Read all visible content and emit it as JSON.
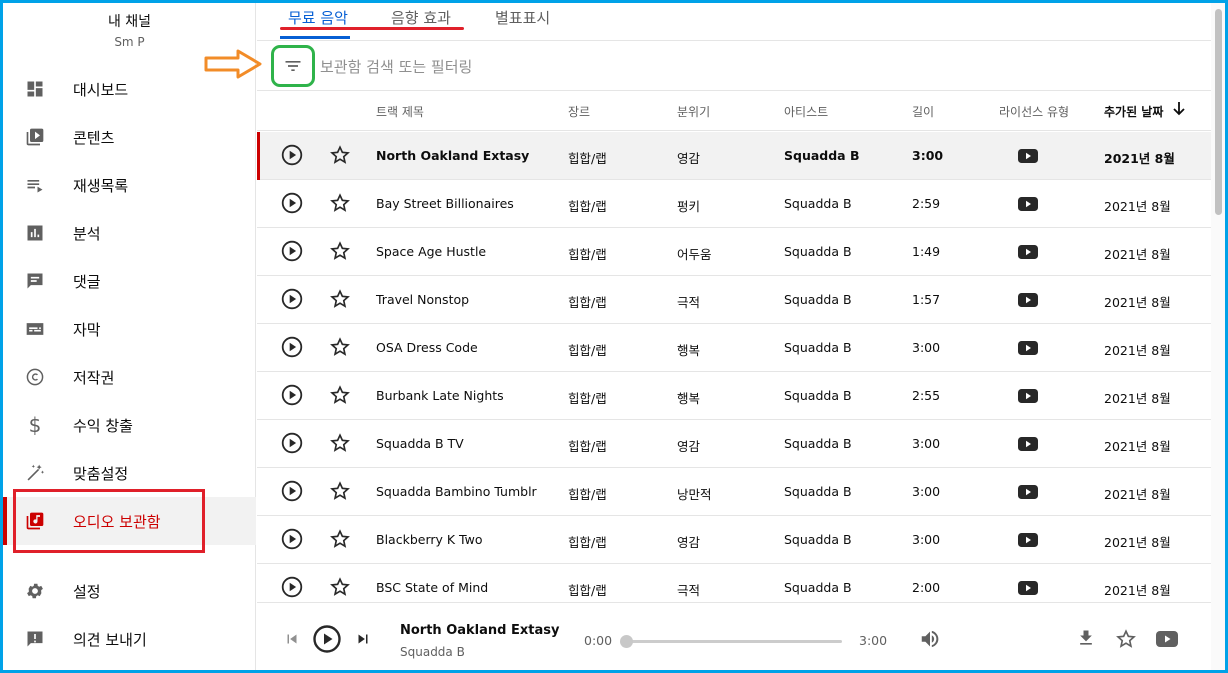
{
  "channel": {
    "name": "내 채널",
    "handle": "Sm P"
  },
  "sidebar": {
    "items": [
      {
        "label": "대시보드",
        "icon": "dashboard-icon"
      },
      {
        "label": "콘텐츠",
        "icon": "content-icon"
      },
      {
        "label": "재생목록",
        "icon": "playlist-icon"
      },
      {
        "label": "분석",
        "icon": "analytics-icon"
      },
      {
        "label": "댓글",
        "icon": "comment-icon"
      },
      {
        "label": "자막",
        "icon": "subtitles-icon"
      },
      {
        "label": "저작권",
        "icon": "copyright-icon"
      },
      {
        "label": "수익 창출",
        "icon": "dollar-icon"
      },
      {
        "label": "맞춤설정",
        "icon": "magic-wand-icon"
      },
      {
        "label": "오디오 보관함",
        "icon": "audio-library-icon",
        "active": true
      },
      {
        "label": "설정",
        "icon": "gear-icon"
      },
      {
        "label": "의견 보내기",
        "icon": "feedback-icon"
      }
    ]
  },
  "tabs": [
    {
      "label": "무료 음악",
      "active": true
    },
    {
      "label": "음향 효과"
    },
    {
      "label": "별표표시"
    }
  ],
  "filter": {
    "placeholder": "보관함 검색 또는 필터링"
  },
  "columns": {
    "title": "트랙 제목",
    "genre": "장르",
    "mood": "분위기",
    "artist": "아티스트",
    "length": "길이",
    "license": "라이선스 유형",
    "date": "추가된 날짜",
    "sort_icon": "arrow-down-icon"
  },
  "tracks": [
    {
      "title": "North Oakland Extasy",
      "genre": "힙합/랩",
      "mood": "영감",
      "artist": "Squadda B",
      "length": "3:00",
      "date": "2021년 8월"
    },
    {
      "title": "Bay Street Billionaires",
      "genre": "힙합/랩",
      "mood": "펑키",
      "artist": "Squadda B",
      "length": "2:59",
      "date": "2021년 8월"
    },
    {
      "title": "Space Age Hustle",
      "genre": "힙합/랩",
      "mood": "어두움",
      "artist": "Squadda B",
      "length": "1:49",
      "date": "2021년 8월"
    },
    {
      "title": "Travel Nonstop",
      "genre": "힙합/랩",
      "mood": "극적",
      "artist": "Squadda B",
      "length": "1:57",
      "date": "2021년 8월"
    },
    {
      "title": "OSA Dress Code",
      "genre": "힙합/랩",
      "mood": "행복",
      "artist": "Squadda B",
      "length": "3:00",
      "date": "2021년 8월"
    },
    {
      "title": "Burbank Late Nights",
      "genre": "힙합/랩",
      "mood": "행복",
      "artist": "Squadda B",
      "length": "2:55",
      "date": "2021년 8월"
    },
    {
      "title": "Squadda B TV",
      "genre": "힙합/랩",
      "mood": "영감",
      "artist": "Squadda B",
      "length": "3:00",
      "date": "2021년 8월"
    },
    {
      "title": "Squadda Bambino Tumblr",
      "genre": "힙합/랩",
      "mood": "낭만적",
      "artist": "Squadda B",
      "length": "3:00",
      "date": "2021년 8월"
    },
    {
      "title": "Blackberry K Two",
      "genre": "힙합/랩",
      "mood": "영감",
      "artist": "Squadda B",
      "length": "3:00",
      "date": "2021년 8월"
    },
    {
      "title": "BSC State of Mind",
      "genre": "힙합/랩",
      "mood": "극적",
      "artist": "Squadda B",
      "length": "2:00",
      "date": "2021년 8월"
    }
  ],
  "player": {
    "title": "North Oakland Extasy",
    "artist": "Squadda B",
    "current": "0:00",
    "duration": "3:00",
    "progress": 0
  },
  "colors": {
    "accent": "#065fd4",
    "active_red": "#cc0000",
    "annotation_red": "#e0202a",
    "annotation_green": "#2fb34a",
    "annotation_orange": "#f28c28",
    "frame_blue": "#00a2e8"
  }
}
